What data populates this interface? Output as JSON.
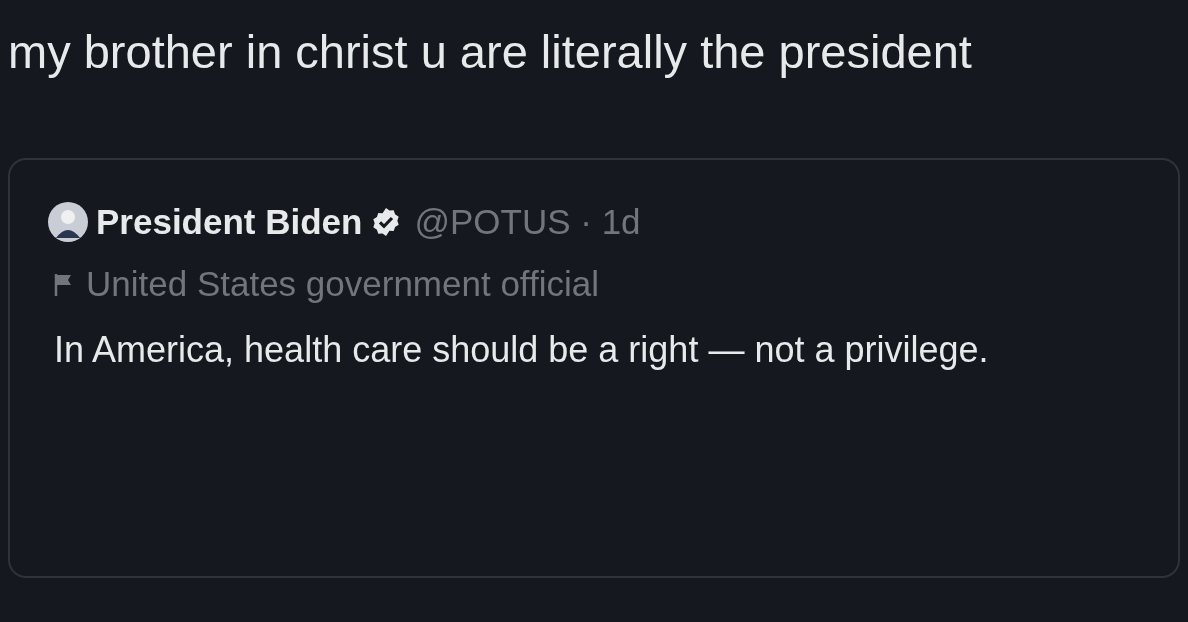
{
  "tweet": {
    "text": "my brother in christ u are literally the president"
  },
  "quoted_tweet": {
    "author": {
      "name": "President Biden",
      "verified": true,
      "handle_time": "@POTUS · 1d"
    },
    "label": "United States government official",
    "text": "In America, health care should be a right — not a privilege."
  }
}
